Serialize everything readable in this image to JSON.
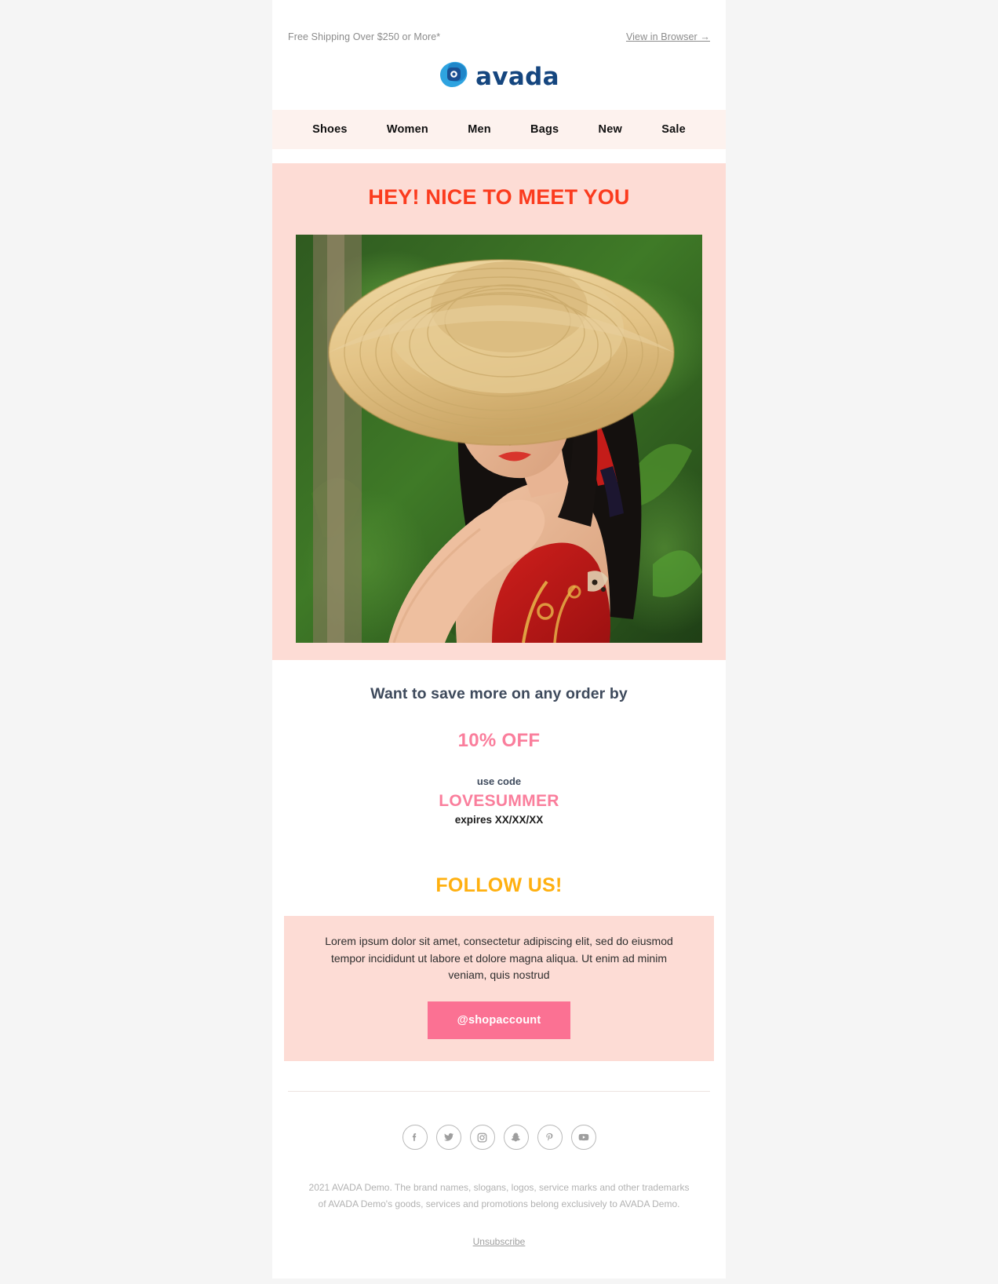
{
  "preheader": {
    "shipping_note": "Free Shipping Over $250 or More*",
    "view_in_browser": "View in Browser →"
  },
  "brand": {
    "name": "avada",
    "logo_icon": "avada-blob-logo",
    "logo_blob_color": "#2ea3e0",
    "logo_badge_color": "#1a4f93",
    "wordmark_color": "#15467f"
  },
  "nav": {
    "items": [
      {
        "label": "Shoes"
      },
      {
        "label": "Women"
      },
      {
        "label": "Men"
      },
      {
        "label": "Bags"
      },
      {
        "label": "New"
      },
      {
        "label": "Sale"
      }
    ]
  },
  "hero": {
    "title": "HEY! NICE TO MEET YOU",
    "title_color": "#fb3b1e",
    "background_color": "#fddcd5",
    "photo_alt": "Woman in straw hat and red patterned swimsuit with sunglasses outdoors among green foliage"
  },
  "offer": {
    "headline": "Want to save more on any order by",
    "discount": "10% OFF",
    "discount_color": "#fa7e9c",
    "use_code_label": "use code",
    "code": "LOVESUMMER",
    "expires": "expires XX/XX/XX"
  },
  "follow": {
    "title": "FOLLOW US!",
    "title_color": "#ffb010",
    "description": "Lorem ipsum dolor sit amet, consectetur adipiscing elit, sed do eiusmod tempor incididunt ut labore et dolore magna aliqua. Ut enim ad minim veniam, quis nostrud",
    "button_label": "@shopaccount",
    "button_color": "#fb7193",
    "card_background": "#fddcd5"
  },
  "footer": {
    "socials": [
      {
        "name": "facebook-icon",
        "glyph": "f"
      },
      {
        "name": "twitter-icon",
        "glyph": "t"
      },
      {
        "name": "instagram-icon",
        "glyph": "i"
      },
      {
        "name": "snapchat-icon",
        "glyph": "s"
      },
      {
        "name": "pinterest-icon",
        "glyph": "p"
      },
      {
        "name": "youtube-icon",
        "glyph": "y"
      }
    ],
    "legal_line_1": "2021 AVADA Demo. The brand names, slogans, logos, service marks and other trademarks",
    "legal_line_2": "of AVADA Demo's goods, services and promotions belong exclusively to AVADA Demo.",
    "unsubscribe": "Unsubscribe"
  }
}
